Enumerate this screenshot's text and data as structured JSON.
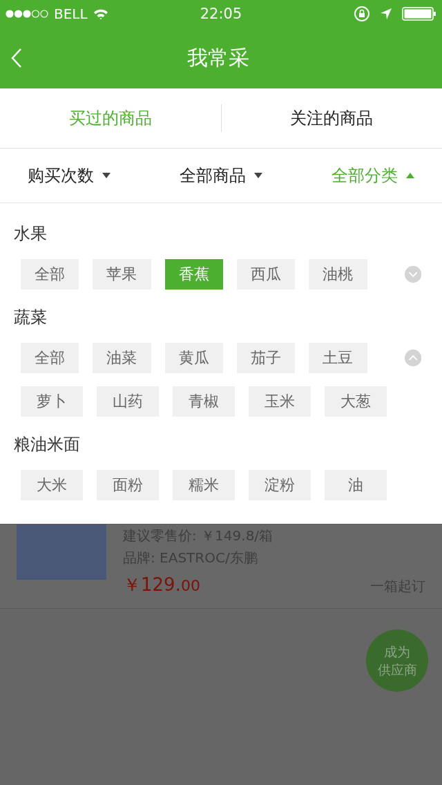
{
  "status_bar": {
    "carrier": "BELL",
    "time": "22:05"
  },
  "nav": {
    "title": "我常采"
  },
  "tabs": [
    {
      "label": "买过的商品",
      "selected": true
    },
    {
      "label": "关注的商品",
      "selected": false
    }
  ],
  "filters": [
    {
      "label": "购买次数",
      "selected": false
    },
    {
      "label": "全部商品",
      "selected": false
    },
    {
      "label": "全部分类",
      "selected": true
    }
  ],
  "categories": [
    {
      "title": "水果",
      "expanded": false,
      "items": [
        {
          "label": "全部",
          "selected": false
        },
        {
          "label": "苹果",
          "selected": false
        },
        {
          "label": "香蕉",
          "selected": true
        },
        {
          "label": "西瓜",
          "selected": false
        },
        {
          "label": "油桃",
          "selected": false
        }
      ]
    },
    {
      "title": "蔬菜",
      "expanded": true,
      "items": [
        {
          "label": "全部",
          "selected": false
        },
        {
          "label": "油菜",
          "selected": false
        },
        {
          "label": "黄瓜",
          "selected": false
        },
        {
          "label": "茄子",
          "selected": false
        },
        {
          "label": "土豆",
          "selected": false
        },
        {
          "label": "萝卜",
          "selected": false
        },
        {
          "label": "山药",
          "selected": false
        },
        {
          "label": "青椒",
          "selected": false
        },
        {
          "label": "玉米",
          "selected": false
        },
        {
          "label": "大葱",
          "selected": false
        }
      ]
    },
    {
      "title": "粮油米面",
      "items": [
        {
          "label": "大米",
          "selected": false
        },
        {
          "label": "面粉",
          "selected": false
        },
        {
          "label": "糯米",
          "selected": false
        },
        {
          "label": "淀粉",
          "selected": false
        },
        {
          "label": "油",
          "selected": false
        }
      ]
    }
  ],
  "product": {
    "retail_price": "建议零售价: ￥149.8/箱",
    "brand": "品牌: EASTROC/东鹏",
    "price": "￥129.",
    "price_cents": "00",
    "min_order": "一箱起订"
  },
  "fab": {
    "label_line_1": "成为",
    "label_line_2": "供应商"
  }
}
